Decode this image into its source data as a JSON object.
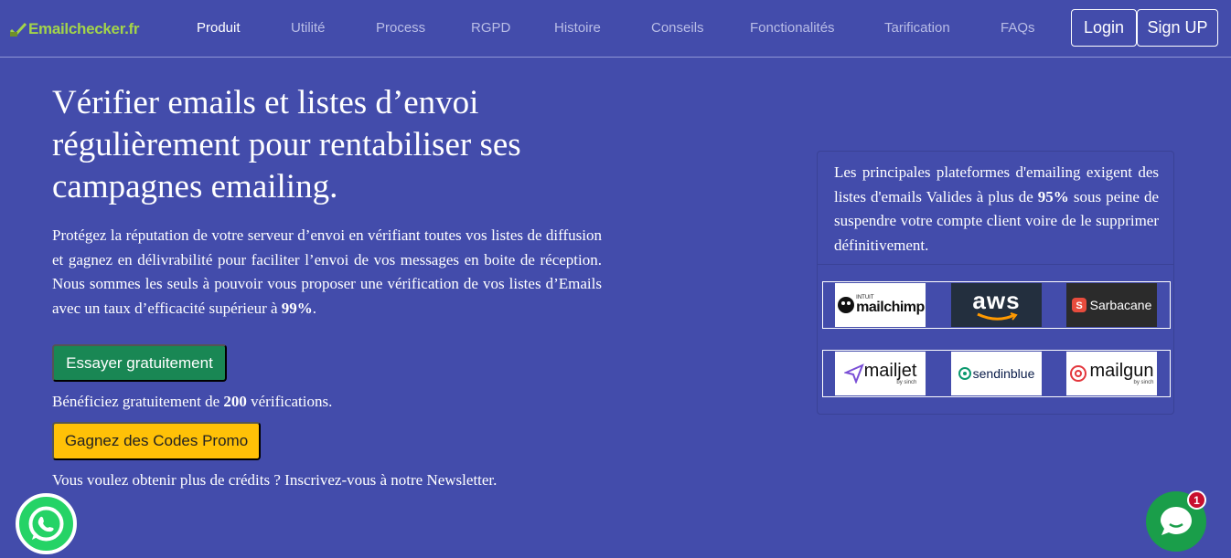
{
  "brand": {
    "name_part1": "Email",
    "name_part2": "checker.fr",
    "icon": "checkmark-envelope-icon",
    "color": "#a3d44a"
  },
  "nav": {
    "links": [
      "Produit",
      "Utilité",
      "Process",
      "RGPD",
      "Histoire",
      "Conseils",
      "Fonctionalités",
      "Tarification",
      "FAQs"
    ],
    "active": "Produit",
    "login_label": "Login",
    "signup_label": "Sign UP"
  },
  "hero": {
    "title": "Vérifier emails et listes d’envoi régulièrement pour rentabiliser ses campagnes emailing.",
    "text_before": "Protégez la réputation de votre serveur d’envoi en vérifiant toutes vos listes de diffusion et gagnez en délivrabilité pour faciliter l’envoi de vos messages en boite de réception. Nous sommes les seuls à pouvoir vous proposer une vérification de vos listes d’Emails avec un taux d’efficacité supérieur à ",
    "text_bold": "99%",
    "text_after": ".",
    "try_button": "Essayer gratuitement",
    "free_before": "Bénéficiez gratuitement de ",
    "free_bold": "200",
    "free_after": " vérifications.",
    "promo_button": "Gagnez des Codes Promo",
    "newsletter_text": "Vous voulez obtenir plus de crédits ? Inscrivez-vous à notre Newsletter."
  },
  "info_card": {
    "text_before": "Les principales plateformes d'emailing exigent des listes d'emails Valides à plus de ",
    "text_bold": "95%",
    "text_after": " sous peine de suspendre votre compte client voire de le supprimer définitivement.",
    "logos_row1": [
      {
        "name": "mailchimp",
        "prefix": "INTUIT",
        "icon": "mailchimp-icon"
      },
      {
        "name": "aws",
        "icon": "aws-smile-icon"
      },
      {
        "name": "Sarbacane",
        "icon": "sarbacane-icon"
      }
    ],
    "logos_row2": [
      {
        "name": "mailjet",
        "sub": "by sinch",
        "icon": "mailjet-plane-icon"
      },
      {
        "name": "sendinblue",
        "icon": "sendinblue-icon"
      },
      {
        "name": "mailgun",
        "sub": "by sinch",
        "icon": "mailgun-icon"
      }
    ]
  },
  "widgets": {
    "whatsapp_icon": "whatsapp-icon",
    "chat_icon": "chat-bubble-icon",
    "chat_badge_count": "1"
  },
  "colors": {
    "background": "#434cab",
    "try_button": "#198754",
    "promo_button": "#ffc107",
    "whatsapp": "#25d366",
    "chat": "#1a9e4a",
    "badge": "#c8102e"
  }
}
